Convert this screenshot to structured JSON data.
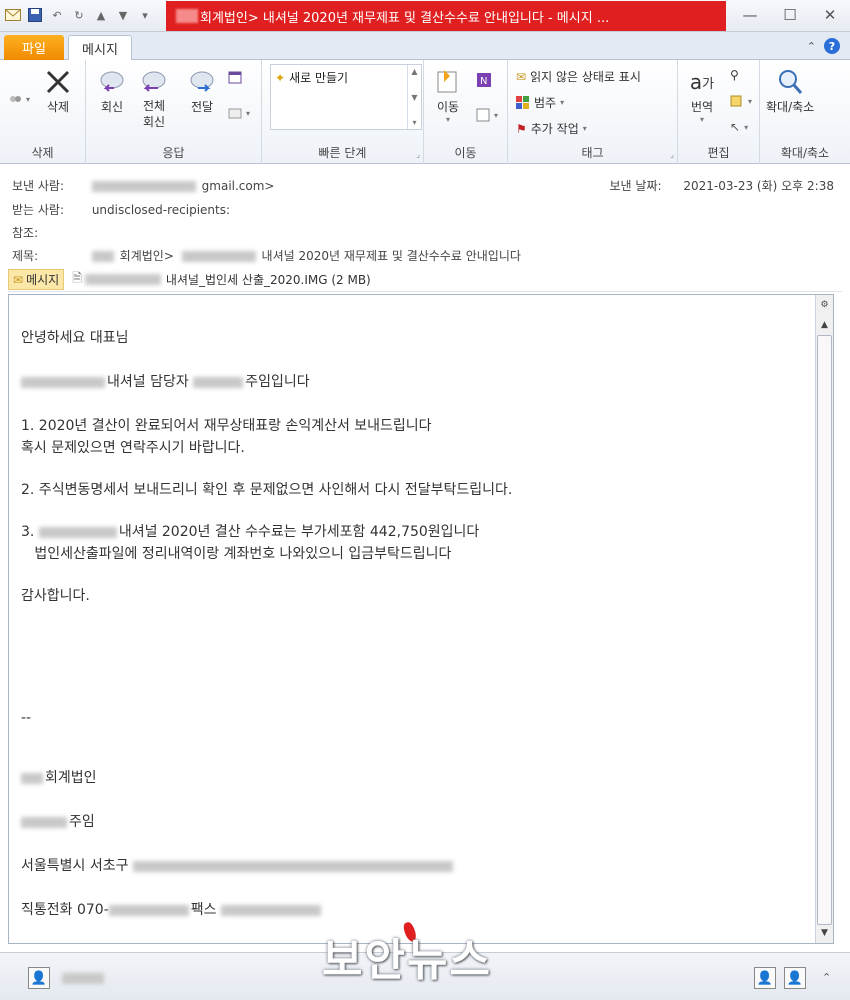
{
  "window": {
    "title": "회계법인> 내셔널 2020년 재무제표 및 결산수수료 안내입니다 - 메시지 ...",
    "controls": [
      "minimize-icon",
      "maximize-icon",
      "close-icon"
    ]
  },
  "tabs": {
    "file": "파일",
    "message": "메시지"
  },
  "ribbon": {
    "delete_group": {
      "label": "삭제",
      "delete_btn": "삭제"
    },
    "respond_group": {
      "label": "응답",
      "reply": "회신",
      "reply_all_1": "전체",
      "reply_all_2": "회신",
      "forward": "전달"
    },
    "quicksteps_group": {
      "label": "빠른 단계",
      "new": "새로 만들기"
    },
    "move_group": {
      "label": "이동",
      "move": "이동"
    },
    "tags_group": {
      "label": "태그",
      "mark_unread": "읽지 않은 상태로 표시",
      "categorize": "범주",
      "followup": "추가 작업"
    },
    "edit_group": {
      "label": "편집",
      "translate": "번역"
    },
    "zoom_group": {
      "label": "확대/축소",
      "zoom": "확대/축소"
    }
  },
  "header": {
    "from_label": "보낸 사람:",
    "from_value": "gmail.com>",
    "date_label": "보낸 날짜:",
    "date_value": "2021-03-23 (화) 오후 2:38",
    "to_label": "받는 사람:",
    "to_value": "undisclosed-recipients:",
    "cc_label": "참조:",
    "subject_label": "제목:",
    "subject_value_1": "회계법인>",
    "subject_value_2": "내셔널 2020년 재무제표 및 결산수수료 안내입니다"
  },
  "attachments": {
    "message_tab": "메시지",
    "file_name": "내셔널_법인세 산출_2020.IMG (2 MB)"
  },
  "body": {
    "greeting": "안녕하세요 대표님",
    "intro": "내셔널 담당자 ",
    "intro_end": "주임입니다",
    "item1_line1": "1. 2020년 결산이 완료되어서 재무상태표랑 손익계산서 보내드립니다",
    "item1_line2": "혹시 문제있으면 연락주시기 바랍니다.",
    "item2": "2. 주식변동명세서 보내드리니 확인 후 문제없으면 사인해서 다시 전달부탁드립니다.",
    "item3_prefix": "3. ",
    "item3_line1": "내셔널 2020년 결산 수수료는 부가세포함 442,750원입니다",
    "item3_line2": "   법인세산출파일에 정리내역이랑 계좌번호 나와있으니 입금부탁드립니다",
    "thanks": "감사합니다.",
    "sig_dash": "--",
    "sig_company": "회계법인",
    "sig_title": "주임",
    "sig_address": "서울특별시 서초구 ",
    "sig_phone_label": "직통전화 070-",
    "sig_fax_label": "팩스 "
  },
  "watermark": "보안뉴스"
}
